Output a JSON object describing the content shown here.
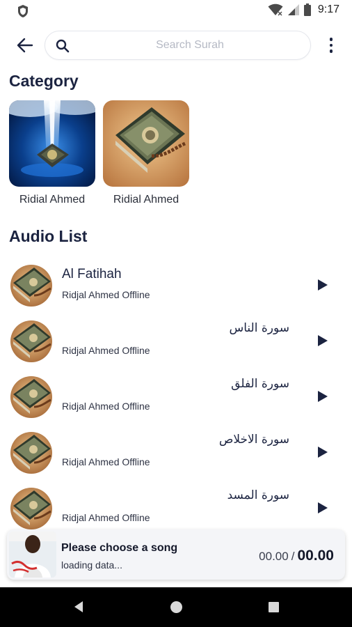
{
  "status_bar": {
    "time": "9:17",
    "icons": [
      "shield-icon",
      "wifi-icon",
      "signal-icon",
      "battery-icon"
    ]
  },
  "header": {
    "search_placeholder": "Search Surah",
    "search_value": "",
    "icons": [
      "back-arrow-icon",
      "search-icon",
      "more-vert-icon"
    ]
  },
  "category": {
    "title": "Category",
    "items": [
      {
        "label": "Ridial Ahmed"
      },
      {
        "label": "Ridial Ahmed"
      }
    ]
  },
  "audio_list": {
    "title": "Audio List",
    "items": [
      {
        "title": "Al Fatihah",
        "subtitle": "Ridjal Ahmed Offline"
      },
      {
        "title": "سورة الناس",
        "subtitle": "Ridjal Ahmed Offline"
      },
      {
        "title": "سورة الفلق",
        "subtitle": "Ridjal Ahmed Offline"
      },
      {
        "title": "سورة الاخلاص",
        "subtitle": "Ridjal Ahmed Offline"
      },
      {
        "title": "سورة المسد",
        "subtitle": "Ridjal Ahmed Offline"
      }
    ]
  },
  "player": {
    "title": "Please choose a song",
    "status": "loading data...",
    "current_time": "00.00",
    "separator": "/",
    "total_time": "00.00"
  },
  "colors": {
    "primary_text": "#1b2340",
    "accent": "#1b2340",
    "player_bg": "#f4f5f8"
  }
}
